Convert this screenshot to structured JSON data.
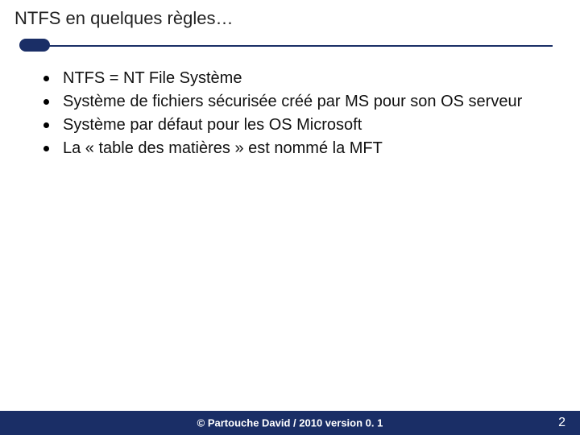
{
  "title": "NTFS en quelques règles…",
  "bullets": [
    "NTFS = NT File Système",
    "Système de fichiers sécurisée créé par MS pour son OS serveur",
    "Système par défaut pour les OS Microsoft",
    "La « table des matières » est nommé la MFT"
  ],
  "footer": {
    "copyright": "© Partouche David / 2010 version 0. 1",
    "page": "2"
  }
}
